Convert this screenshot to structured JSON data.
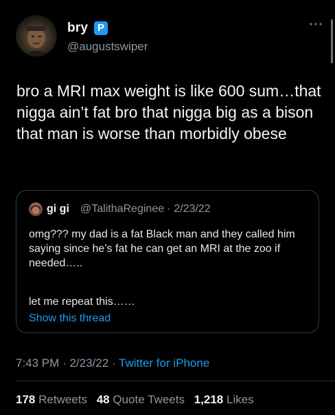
{
  "tweet": {
    "author": {
      "display_name": "bry",
      "badge_letter": "P",
      "handle": "@augustswiper"
    },
    "more_icon": "more-horizontal-icon",
    "text": "bro a MRI max weight is like 600 sum…that nigga ain’t fat bro that nigga big as a bison that man is worse than morbidly obese",
    "quoted": {
      "display_name": "gi gi",
      "handle_date": "@TalithaReginee · 2/23/22",
      "text": "omg??? my dad is a fat Black man and they called him saying since he’s fat he can get an MRI at the zoo if needed…..",
      "text_2": "let me repeat this……",
      "show_thread_label": "Show this thread"
    },
    "time": "7:43 PM",
    "date": "2/23/22",
    "separator": "·",
    "source": "Twitter for iPhone",
    "stats": {
      "retweets_count": "178",
      "retweets_label": "Retweets",
      "quotes_count": "48",
      "quotes_label": "Quote Tweets",
      "likes_count": "1,218",
      "likes_label": "Likes"
    }
  },
  "colors": {
    "background": "#000000",
    "text": "#e7e9ea",
    "secondary_text": "#8b98a5",
    "accent": "#1d9bf0",
    "border": "#333a40"
  }
}
